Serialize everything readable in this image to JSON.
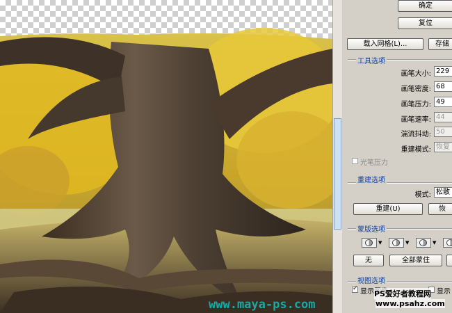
{
  "buttons": {
    "ok": "确定",
    "reset": "复位",
    "load_mesh": "载入网格(L)...",
    "save_mesh": "存储"
  },
  "tool_options": {
    "title": "工具选项",
    "brush_size_label": "画笔大小:",
    "brush_size": "229",
    "brush_density_label": "画笔密度:",
    "brush_density": "68",
    "brush_pressure_label": "画笔压力:",
    "brush_pressure": "49",
    "brush_rate_label": "画笔速率:",
    "brush_rate": "44",
    "turbulent_jitter_label": "湍流抖动:",
    "turbulent_jitter": "50",
    "reconstruct_mode_label": "重建模式:",
    "reconstruct_mode": "恢复",
    "stylus_pressure": "光笔压力"
  },
  "reconstruct_options": {
    "title": "重建选项",
    "mode_label": "模式:",
    "mode": "松散",
    "reconstruct_button": "重建(U)",
    "restore_button": "恢"
  },
  "mask_options": {
    "title": "蒙版选项",
    "none_button": "无",
    "mask_all_button": "全部蒙住",
    "invert_button": "全"
  },
  "view_options": {
    "title": "视图选项",
    "show_image": "显示图像",
    "show_mesh": "显示"
  },
  "watermark": {
    "site": "www.maya-ps.com",
    "site_cn": "PS爱好者教程网",
    "site_url": "www.psahz.com"
  }
}
